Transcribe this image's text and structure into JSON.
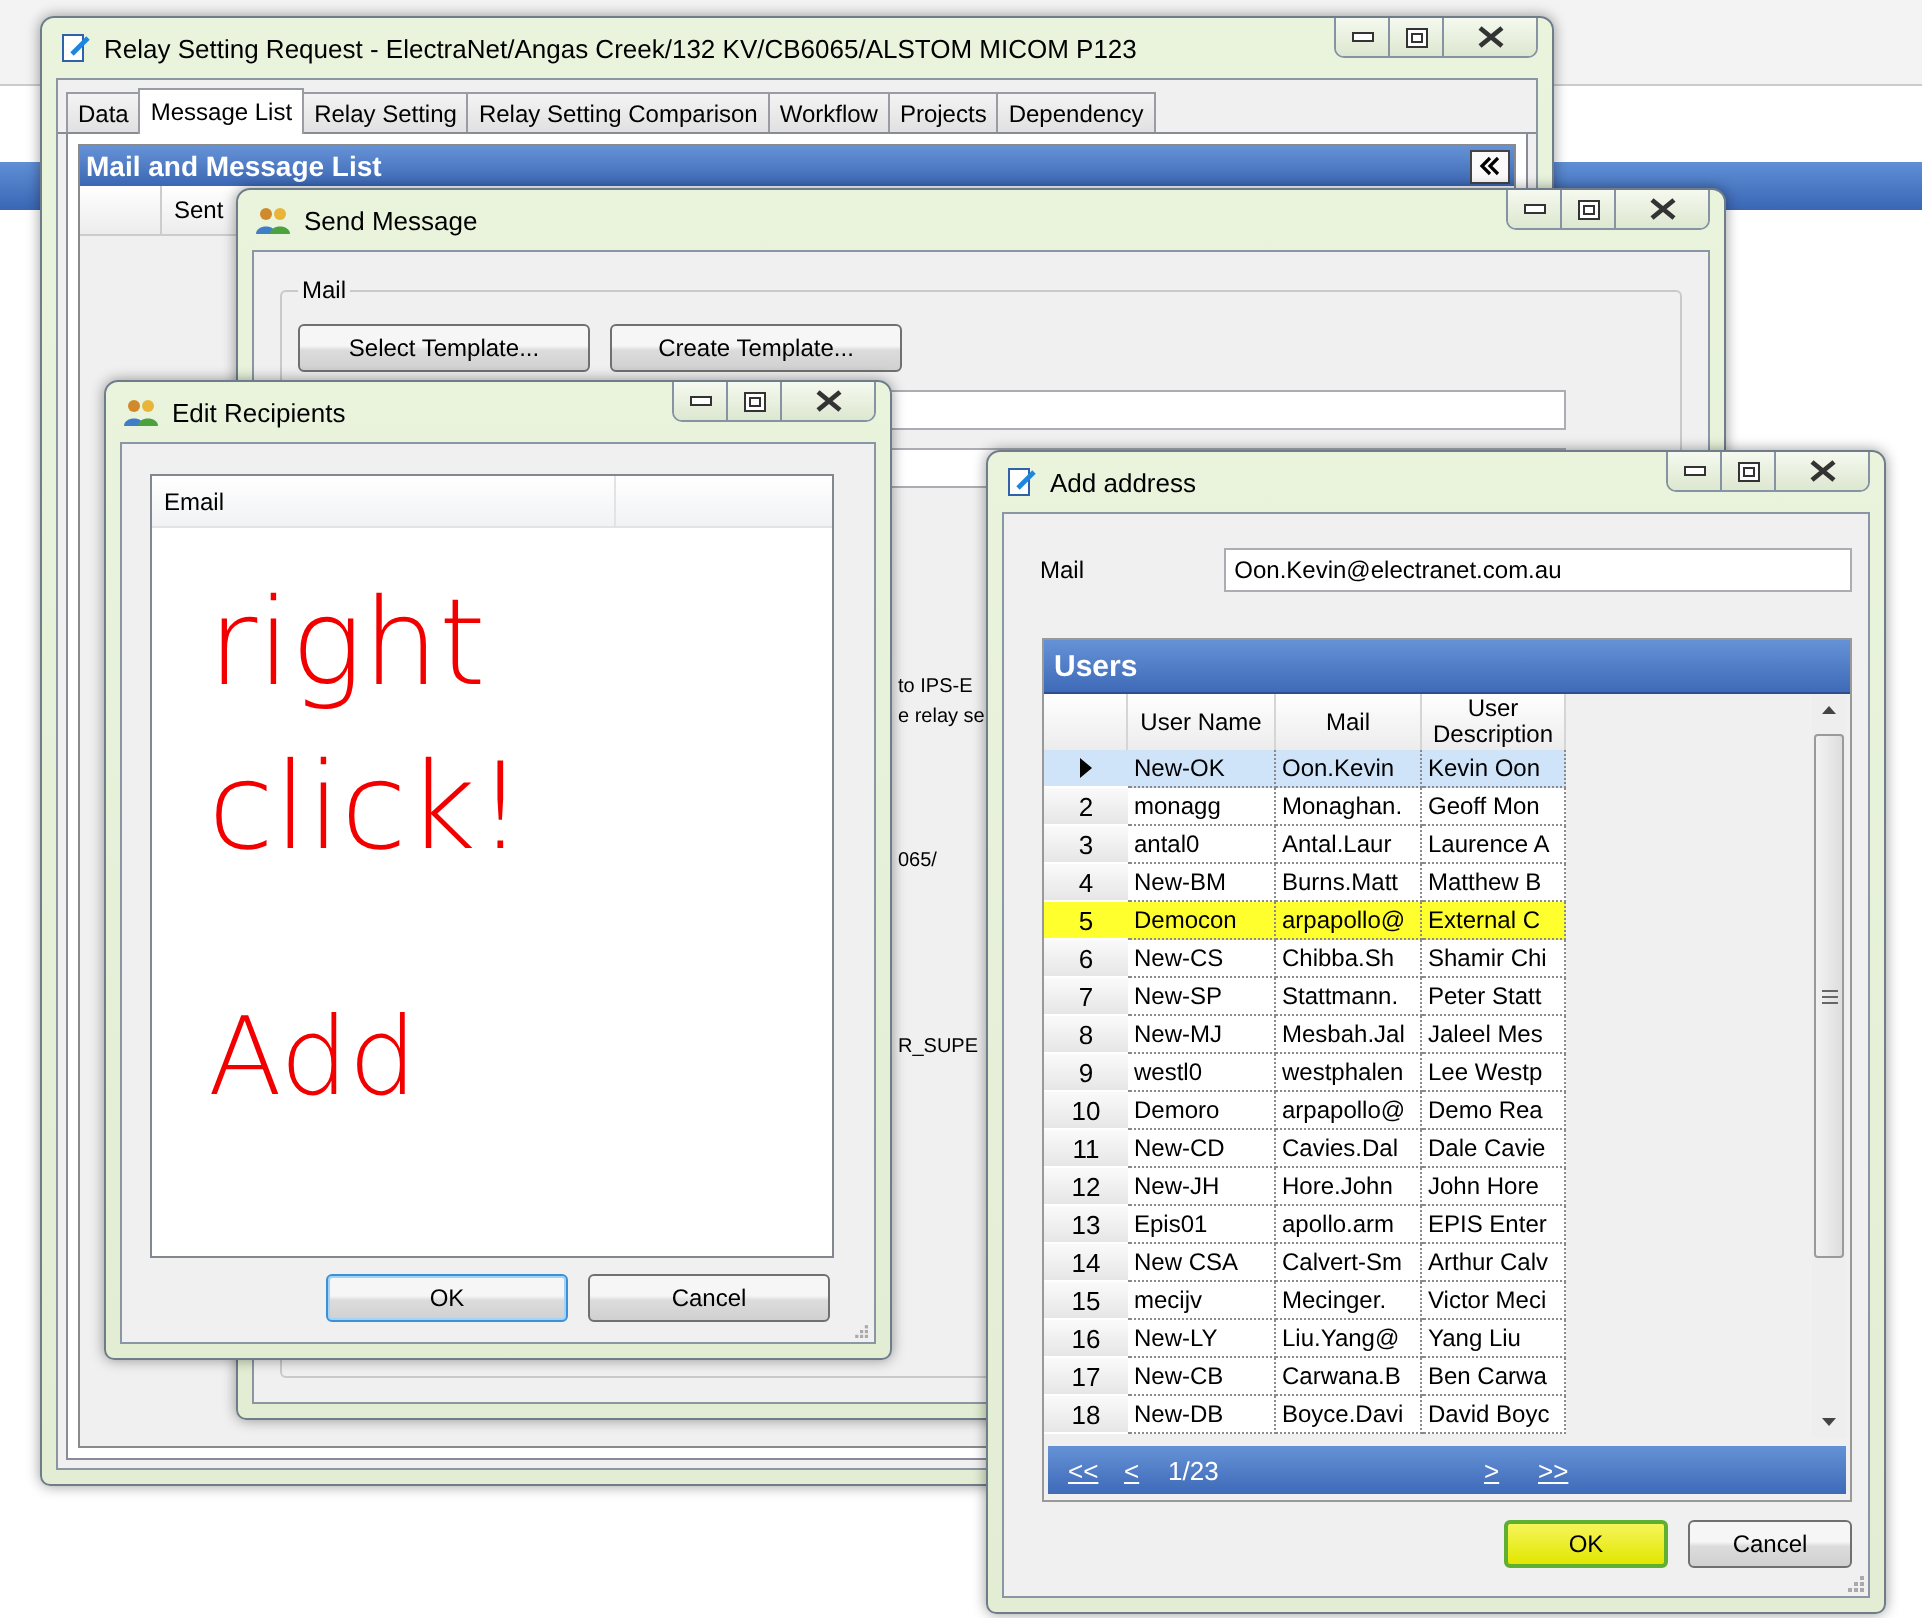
{
  "main_window": {
    "title": "Relay Setting Request - ElectraNet/Angas Creek/132 KV/CB6065/ALSTOM MICOM P123",
    "tabs": [
      {
        "label": "Data",
        "selected": false
      },
      {
        "label": "Message List",
        "selected": true
      },
      {
        "label": "Relay Setting",
        "selected": false
      },
      {
        "label": "Relay Setting Comparison",
        "selected": false
      },
      {
        "label": "Workflow",
        "selected": false
      },
      {
        "label": "Projects",
        "selected": false
      },
      {
        "label": "Dependency",
        "selected": false
      }
    ],
    "panel_title": "Mail and Message List",
    "column_header": "Sent"
  },
  "send_message": {
    "title": "Send Message",
    "group_label": "Mail",
    "buttons": [
      "Select Template...",
      "Create Template..."
    ],
    "text_fragments": [
      "to IPS-E",
      "e relay se",
      "065/",
      "R_SUPE"
    ]
  },
  "edit_recipients": {
    "title": "Edit Recipients",
    "columns": [
      "Email"
    ],
    "annotations": [
      "right",
      "click!",
      "Add"
    ],
    "buttons": [
      {
        "label": "OK",
        "focused": true
      },
      {
        "label": "Cancel",
        "focused": false
      }
    ]
  },
  "add_address": {
    "title": "Add address",
    "mail_label": "Mail",
    "mail_value": "Oon.Kevin@electranet.com.au",
    "grid_title": "Users",
    "columns": [
      "User Name",
      "Mail",
      "User Description"
    ],
    "rows": [
      {
        "selected": true,
        "highlighted": false,
        "cells": [
          "New-OK",
          "Oon.Kevin",
          "Kevin Oon"
        ]
      },
      {
        "number": "2",
        "selected": false,
        "highlighted": false,
        "cells": [
          "monagg",
          "Monaghan.",
          "Geoff Mon"
        ]
      },
      {
        "number": "3",
        "selected": false,
        "highlighted": false,
        "cells": [
          "antal0",
          "Antal.Laur",
          "Laurence A"
        ]
      },
      {
        "number": "4",
        "selected": false,
        "highlighted": false,
        "cells": [
          "New-BM",
          "Burns.Matt",
          "Matthew B"
        ]
      },
      {
        "number": "5",
        "selected": false,
        "highlighted": true,
        "cells": [
          "Democon",
          "arpapollo@",
          "External C"
        ]
      },
      {
        "number": "6",
        "selected": false,
        "highlighted": false,
        "cells": [
          "New-CS",
          "Chibba.Sh",
          "Shamir Chi"
        ]
      },
      {
        "number": "7",
        "selected": false,
        "highlighted": false,
        "cells": [
          "New-SP",
          "Stattmann.",
          "Peter Statt"
        ]
      },
      {
        "number": "8",
        "selected": false,
        "highlighted": false,
        "cells": [
          "New-MJ",
          "Mesbah.Jal",
          "Jaleel Mes"
        ]
      },
      {
        "number": "9",
        "selected": false,
        "highlighted": false,
        "cells": [
          "westl0",
          "westphalen",
          "Lee Westp"
        ]
      },
      {
        "number": "10",
        "selected": false,
        "highlighted": false,
        "cells": [
          "Demoro",
          "arpapollo@",
          "Demo Rea"
        ]
      },
      {
        "number": "11",
        "selected": false,
        "highlighted": false,
        "cells": [
          "New-CD",
          "Cavies.Dal",
          "Dale Cavie"
        ]
      },
      {
        "number": "12",
        "selected": false,
        "highlighted": false,
        "cells": [
          "New-JH",
          "Hore.John",
          "John Hore"
        ]
      },
      {
        "number": "13",
        "selected": false,
        "highlighted": false,
        "cells": [
          "Epis01",
          "apollo.arm",
          "EPIS Enter"
        ]
      },
      {
        "number": "14",
        "selected": false,
        "highlighted": false,
        "cells": [
          "New CSA",
          "Calvert-Sm",
          "Arthur Calv"
        ]
      },
      {
        "number": "15",
        "selected": false,
        "highlighted": false,
        "cells": [
          "mecijv",
          "Mecinger.",
          "Victor Meci"
        ]
      },
      {
        "number": "16",
        "selected": false,
        "highlighted": false,
        "cells": [
          "New-LY",
          "Liu.Yang@",
          "Yang Liu"
        ]
      },
      {
        "number": "17",
        "selected": false,
        "highlighted": false,
        "cells": [
          "New-CB",
          "Carwana.B",
          "Ben Carwa"
        ]
      },
      {
        "number": "18",
        "selected": false,
        "highlighted": false,
        "cells": [
          "New-DB",
          "Boyce.Davi",
          "David Boyc"
        ]
      }
    ],
    "pager": {
      "first": "<<",
      "prev": "<",
      "page": "1/23",
      "next": ">",
      "last": ">>"
    },
    "buttons": [
      {
        "label": "OK",
        "highlighted": true
      },
      {
        "label": "Cancel",
        "highlighted": false
      }
    ]
  }
}
